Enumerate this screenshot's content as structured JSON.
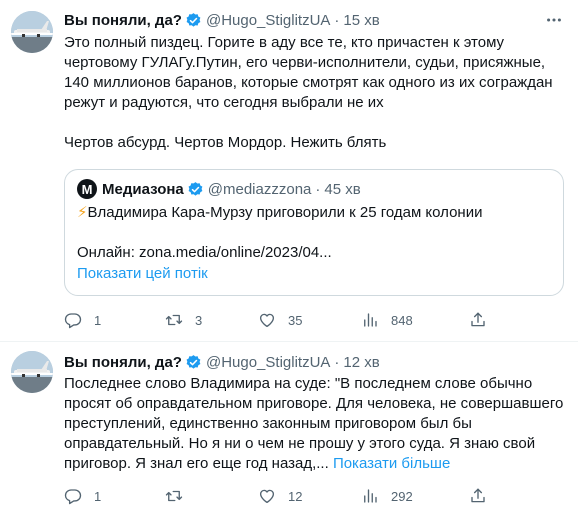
{
  "tweets": [
    {
      "name": "Вы поняли, да?",
      "handle": "@Hugo_StiglitzUA",
      "time": "15 хв",
      "lines": [
        "Это полный пиздец. Горите в аду все те, кто причастен к этому",
        "чертовому ГУЛАГу.Путин, его черви-исполнители, судьи, присяжные,",
        "140 миллионов баранов, которые смотрят как одного из их сограждан",
        "режут и радуются, что сегодня выбрали не их",
        "",
        "Чертов абсурд. Чертов Мордор. Нежить блять"
      ],
      "quote": {
        "logo_letter": "M",
        "name": "Медиазона",
        "handle": "@mediazzzona",
        "time": "45 хв",
        "lines": [
          "Владимира Кара-Мурзу приговорили к 25 годам колонии",
          "",
          "Онлайн: zona.media/online/2023/04..."
        ],
        "show_thread": "Показати цей потік"
      },
      "stats": {
        "replies": "1",
        "retweets": "3",
        "likes": "35",
        "views": "848"
      }
    },
    {
      "name": "Вы поняли, да?",
      "handle": "@Hugo_StiglitzUA",
      "time": "12 хв",
      "lines": [
        "Последнее слово Владимира на суде: \"В последнем слове обычно",
        "просят об оправдательном приговоре. Для человека, не совершавшего",
        "преступлений, единственно законным приговором был бы",
        "оправдательный. Но я ни о чем не прошу у этого суда. Я знаю свой",
        "приговор. Я знал его еще год назад,..."
      ],
      "show_more": "Показати більше",
      "stats": {
        "replies": "1",
        "retweets": "",
        "likes": "12",
        "views": "292"
      }
    }
  ],
  "colors": {
    "accent": "#1d9bf0",
    "muted": "#536471",
    "text": "#0f1419",
    "border": "#cfd9de"
  },
  "icons": [
    "avatar-airplane",
    "verified-badge-icon",
    "more-icon",
    "reply-icon",
    "retweet-icon",
    "like-icon",
    "views-icon",
    "share-icon",
    "lightning-icon"
  ]
}
